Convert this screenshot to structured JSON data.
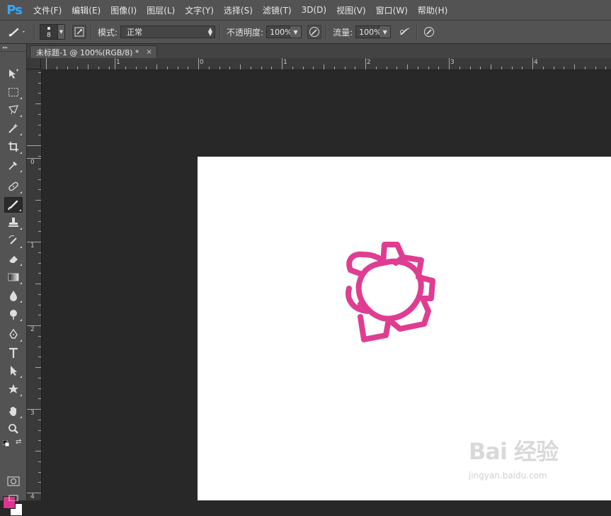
{
  "app": {
    "logo": "Ps"
  },
  "menu": [
    "文件(F)",
    "编辑(E)",
    "图像(I)",
    "图层(L)",
    "文字(Y)",
    "选择(S)",
    "滤镜(T)",
    "3D(D)",
    "视图(V)",
    "窗口(W)",
    "帮助(H)"
  ],
  "options": {
    "brush_size": "8",
    "mode_label": "模式:",
    "mode_value": "正常",
    "opacity_label": "不透明度:",
    "opacity_value": "100%",
    "flow_label": "流量:",
    "flow_value": "100%"
  },
  "document": {
    "tab_title": "未标题-1 @ 100%(RGB/8) *",
    "close_glyph": "×"
  },
  "rulers": {
    "h_labels": [
      "1",
      "0",
      "1",
      "2",
      "3",
      "4"
    ],
    "v_labels": [
      "0",
      "1",
      "2",
      "3",
      "4"
    ]
  },
  "colors": {
    "foreground": "#e0338f",
    "background": "#ffffff",
    "brush_stroke": "#df3d92"
  },
  "tools": [
    "move-tool",
    "marquee-tool",
    "lasso-tool",
    "magic-wand-tool",
    "crop-tool",
    "eyedropper-tool",
    "healing-brush-tool",
    "brush-tool",
    "clone-stamp-tool",
    "history-brush-tool",
    "eraser-tool",
    "gradient-tool",
    "blur-tool",
    "dodge-tool",
    "pen-tool",
    "type-tool",
    "path-selection-tool",
    "shape-tool",
    "hand-tool",
    "zoom-tool"
  ],
  "watermark": {
    "main": "Bai 经验",
    "sub": "jingyan.baidu.com"
  }
}
